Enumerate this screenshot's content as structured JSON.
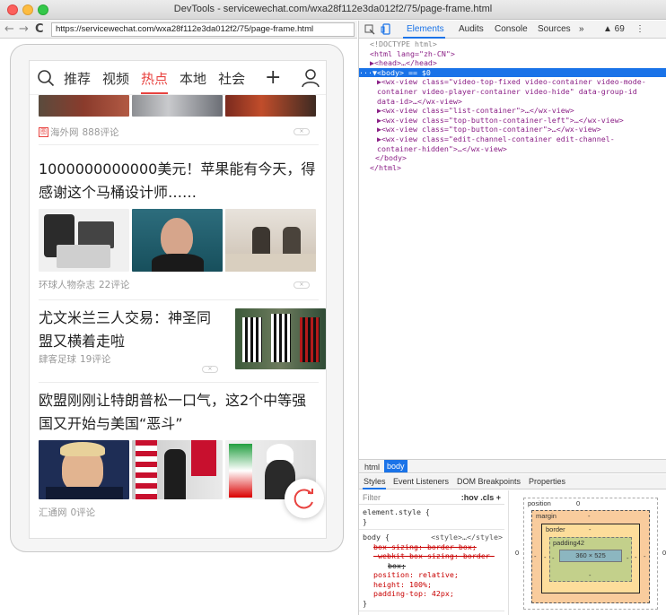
{
  "window": {
    "title": "DevTools - servicewechat.com/wxa28f112e3da012f2/75/page-frame.html"
  },
  "browser": {
    "back": "←",
    "forward": "→",
    "reload": "C",
    "url": "https://servicewechat.com/wxa28f112e3da012f2/75/page-frame.html"
  },
  "app": {
    "tabs": [
      "推荐",
      "视频",
      "热点",
      "本地",
      "社会"
    ],
    "active_tab": "热点",
    "add_label": "+",
    "accent_color": "#e8423f"
  },
  "feed": [
    {
      "source_tag": "图",
      "source": "海外网",
      "comments": "888评论"
    },
    {
      "title": "1000000000000美元！苹果能有今天，得感谢这个马桶设计师……",
      "source": "环球人物杂志",
      "comments": "22评论"
    },
    {
      "title": "尤文米兰三人交易：神圣同盟又横着走啦",
      "source": "肆客足球",
      "comments": "19评论"
    },
    {
      "title": "欧盟刚刚让特朗普松一口气，这2个中等强国又开始与美国“恶斗”",
      "source": "汇通网",
      "comments": "0评论"
    }
  ],
  "devtools": {
    "toolbar": {
      "tabs": [
        "Elements",
        "Audits",
        "Console",
        "Sources"
      ],
      "more": "»",
      "warnings": "▲ 69",
      "menu": "⋮"
    },
    "dom_lines": [
      "<!DOCTYPE html>",
      "<html lang=\"zh-CN\">",
      "▶<head>…</head>",
      "···▼<body> == $0",
      "▶<wx-view class=\"video-top-fixed video-container video-mode-",
      "container video-player-container video-hide\" data-group-id",
      "data-id>…</wx-view>",
      "▶<wx-view class=\"list-container\">…</wx-view>",
      "▶<wx-view class=\"top-button-container-left\">…</wx-view>",
      "▶<wx-view class=\"top-button-container\">…</wx-view>",
      "▶<wx-view class=\"edit-channel-container edit-channel-",
      "container-hidden\">…</wx-view>",
      "</body>",
      "</html>"
    ],
    "breadcrumbs": [
      "html",
      "body"
    ],
    "subtabs": [
      "Styles",
      "Event Listeners",
      "DOM Breakpoints",
      "Properties"
    ],
    "filter_placeholder": "Filter",
    "filter_controls": ":hov  .cls  +",
    "element_style": "element.style {",
    "element_style_close": "}",
    "body_rule": {
      "selector": "body {",
      "source": "<style>…</style>",
      "props": [
        {
          "text": "box-sizing: border-box;",
          "struck": true
        },
        {
          "text": "-webkit-box-sizing: border-",
          "struck": true
        },
        {
          "text": "box;",
          "struck": true
        },
        {
          "text": "position: relative;",
          "struck": false
        },
        {
          "text": "height: 100%;",
          "struck": false
        },
        {
          "text": "padding-top: 42px;",
          "struck": false
        }
      ],
      "close": "}"
    },
    "box_model": {
      "position_label": "position",
      "position_val": "0",
      "margin_label": "margin",
      "margin_val": "-",
      "border_label": "border",
      "border_val": "-",
      "padding_label": "padding42",
      "padding_val": "-",
      "content": "360 × 525",
      "left_outer": "0",
      "right_outer": "0",
      "side_dash": "-"
    }
  }
}
